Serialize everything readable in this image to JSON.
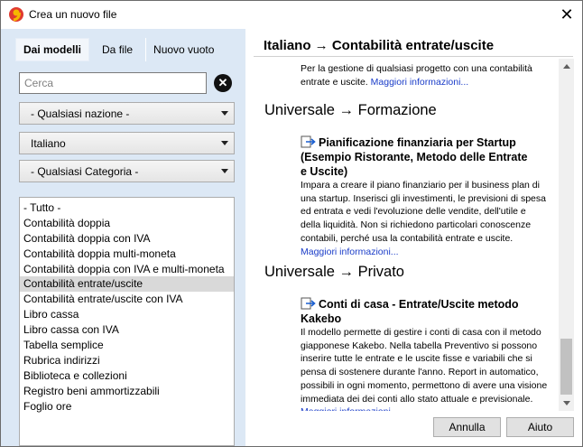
{
  "window": {
    "title": "Crea un nuovo file"
  },
  "tabs": [
    {
      "label": "Dai modelli"
    },
    {
      "label": "Da file"
    },
    {
      "label": "Nuovo vuoto"
    }
  ],
  "search": {
    "placeholder": "Cerca",
    "value": ""
  },
  "filters": {
    "country": "- Qualsiasi nazione -",
    "language": "Italiano",
    "category": "- Qualsiasi Categoria -"
  },
  "categories": [
    "- Tutto -",
    "Contabilità doppia",
    "Contabilità doppia con IVA",
    "Contabilità doppia multi-moneta",
    "Contabilità doppia con IVA e multi-moneta",
    "Contabilità entrate/uscite",
    "Contabilità entrate/uscite con IVA",
    "Libro cassa",
    "Libro cassa con IVA",
    "Tabella semplice",
    "Rubrica indirizzi",
    "Biblioteca e collezioni",
    "Registro beni ammortizzabili",
    "Foglio ore"
  ],
  "selected_category": "Contabilità entrate/uscite",
  "right": {
    "header": "Italiano → Contabilità entrate/uscite",
    "top_partial_text_line1": "Per la gestione di qualsiasi progetto con una contabilità",
    "top_partial_text_line2": "entrate e uscite.",
    "more_info": "Maggiori informazioni...",
    "sections": [
      {
        "heading": "Universale → Formazione",
        "template_title_line1": "Pianificazione finanziaria per Startup",
        "template_title_line2": "(Esempio Ristorante, Metodo delle Entrate",
        "template_title_line3": "e Uscite)",
        "description_lines": [
          "Impara a creare il piano finanziario per il business plan di",
          "una startup. Inserisci gli investimenti, le previsioni di spesa",
          "ed entrata e vedi l'evoluzione delle vendite, dell'utile e",
          "della liquidità. Non si richiedono particolari conoscenze",
          "contabili, perché usa la contabilità entrate e uscite."
        ]
      },
      {
        "heading": "Universale → Privato",
        "template_title_line1": "Conti di casa - Entrate/Uscite metodo",
        "template_title_line2": "Kakebo",
        "description_lines": [
          "Il modello permette di gestire i conti di casa con il metodo",
          "giapponese Kakebo. Nella tabella Preventivo si possono",
          "inserire tutte le entrate e le uscite fisse e variabili che si",
          "pensa di sostenere durante l'anno. Report in automatico,",
          "possibili in ogni momento, permettono di avere una visione",
          "immediata dei dei conti allo stato attuale e previsionale."
        ]
      }
    ]
  },
  "buttons": {
    "cancel": "Annulla",
    "help": "Aiuto"
  },
  "colors": {
    "left_panel_bg": "#dce8f5",
    "link": "#1a3cc8",
    "app_icon_red": "#e03a2f",
    "app_icon_yellow": "#f5b800"
  }
}
